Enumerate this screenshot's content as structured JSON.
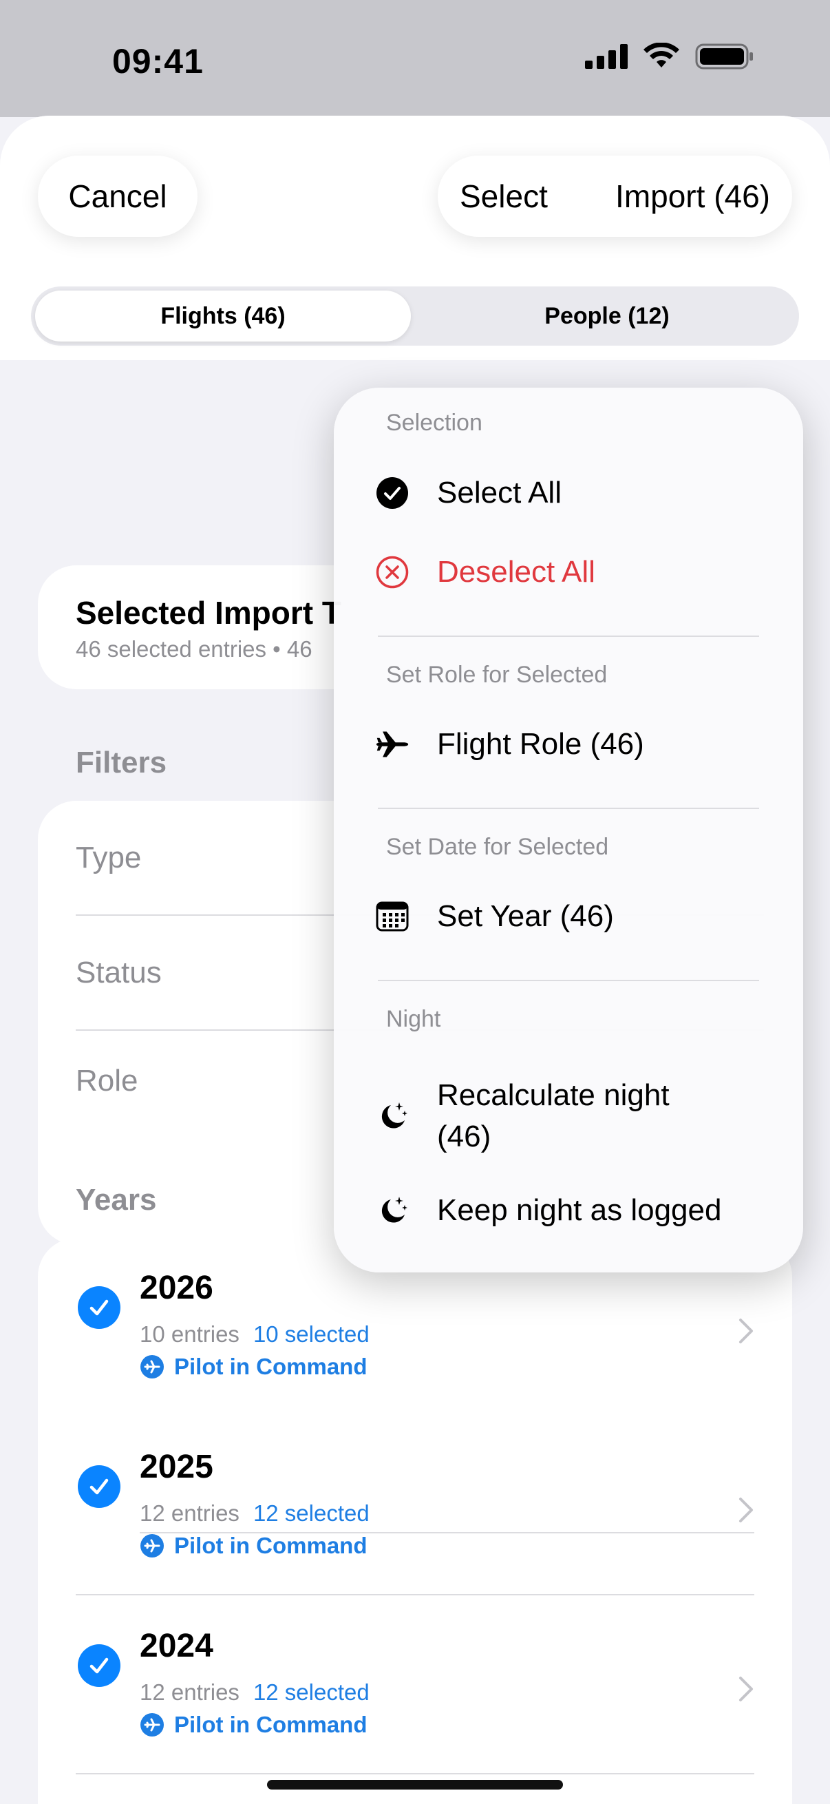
{
  "status_bar": {
    "time": "09:41"
  },
  "header": {
    "cancel_label": "Cancel",
    "select_label": "Select",
    "import_label": "Import (46)"
  },
  "tabs": [
    {
      "label": "Flights (46)",
      "active": true
    },
    {
      "label": "People (12)",
      "active": false
    }
  ],
  "summary_card": {
    "title": "Selected Import T",
    "subtitle": "46 selected entries • 46"
  },
  "filters": {
    "section_title": "Filters",
    "items": [
      {
        "label": "Type"
      },
      {
        "label": "Status"
      },
      {
        "label": "Role"
      }
    ]
  },
  "years": {
    "section_title": "Years",
    "items": [
      {
        "year": "2026",
        "entries": "10 entries",
        "selected": "10 selected",
        "role": "Pilot in Command"
      },
      {
        "year": "2025",
        "entries": "12 entries",
        "selected": "12 selected",
        "role": "Pilot in Command"
      },
      {
        "year": "2024",
        "entries": "12 entries",
        "selected": "12 selected",
        "role": "Pilot in Command"
      }
    ]
  },
  "menu": {
    "selection_header": "Selection",
    "select_all": "Select All",
    "deselect_all": "Deselect All",
    "role_header": "Set Role for Selected",
    "flight_role": "Flight Role (46)",
    "date_header": "Set Date for Selected",
    "set_year": "Set Year (46)",
    "night_header": "Night",
    "recalc_line1": "Recalculate night",
    "recalc_line2": "(46)",
    "keep_night": "Keep night as logged"
  },
  "colors": {
    "accent": "#1e7ee3",
    "destructive": "#e0383e",
    "check": "#0a84ff"
  }
}
